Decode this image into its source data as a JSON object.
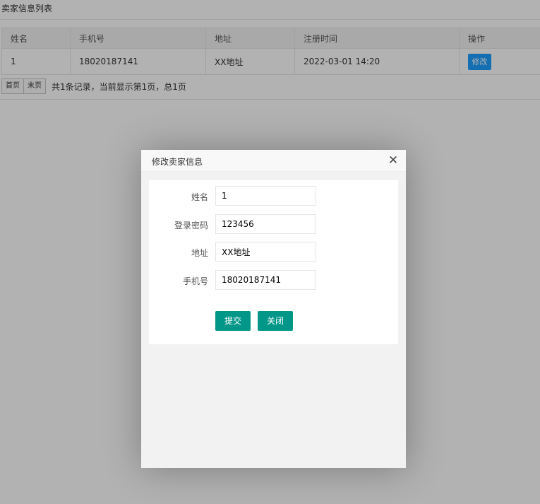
{
  "page": {
    "title": "卖家信息列表"
  },
  "table": {
    "columns": [
      "姓名",
      "手机号",
      "地址",
      "注册时间",
      "操作"
    ],
    "rows": [
      {
        "name": "1",
        "phone": "18020187141",
        "address": "XX地址",
        "registered": "2022-03-01 14:20",
        "action_label": "修改"
      }
    ]
  },
  "pager": {
    "first_label": "首页",
    "last_label": "末页",
    "info": "共1条记录，当前显示第1页，总1页"
  },
  "dialog": {
    "title": "修改卖家信息",
    "close_icon": "close-icon",
    "fields": [
      {
        "label": "姓名",
        "value": "1"
      },
      {
        "label": "登录密码",
        "value": "123456"
      },
      {
        "label": "地址",
        "value": "XX地址"
      },
      {
        "label": "手机号",
        "value": "18020187141"
      }
    ],
    "submit_label": "提交",
    "close_label": "关闭"
  },
  "colors": {
    "edit_button": "#1e9fff",
    "primary_button": "#009688",
    "overlay": "rgba(0,0,0,0.3)"
  }
}
